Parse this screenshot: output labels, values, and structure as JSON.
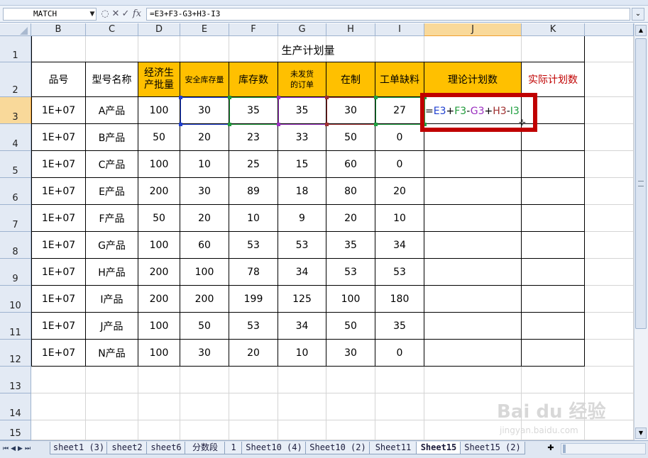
{
  "formula_bar": {
    "name_box": "MATCH",
    "formula": "=E3+F3-G3+H3-I3",
    "fx_label": "fx"
  },
  "columns": [
    "B",
    "C",
    "D",
    "E",
    "F",
    "G",
    "H",
    "I",
    "J",
    "K"
  ],
  "selected_column": "J",
  "rows": [
    "1",
    "2",
    "3",
    "4",
    "5",
    "6",
    "7",
    "8",
    "9",
    "10",
    "11",
    "12",
    "13",
    "14",
    "15"
  ],
  "selected_row": "3",
  "sheet": {
    "title": "生产计划量",
    "headers": [
      "品号",
      "型号名称",
      "经济生产批量",
      "安全库存量",
      "库存数",
      "未发货的订单",
      "在制",
      "工单缺料",
      "理论计划数",
      "实际计划数"
    ],
    "data": [
      [
        "1E+07",
        "A产品",
        "100",
        "30",
        "35",
        "35",
        "30",
        "27"
      ],
      [
        "1E+07",
        "B产品",
        "50",
        "20",
        "23",
        "33",
        "50",
        "0"
      ],
      [
        "1E+07",
        "C产品",
        "100",
        "10",
        "25",
        "15",
        "60",
        "0"
      ],
      [
        "1E+07",
        "E产品",
        "200",
        "30",
        "89",
        "18",
        "80",
        "20"
      ],
      [
        "1E+07",
        "F产品",
        "50",
        "20",
        "10",
        "9",
        "20",
        "10"
      ],
      [
        "1E+07",
        "G产品",
        "100",
        "60",
        "53",
        "53",
        "35",
        "34"
      ],
      [
        "1E+07",
        "H产品",
        "200",
        "100",
        "78",
        "34",
        "53",
        "53"
      ],
      [
        "1E+07",
        "I产品",
        "200",
        "200",
        "199",
        "125",
        "100",
        "180"
      ],
      [
        "1E+07",
        "J产品",
        "100",
        "50",
        "53",
        "34",
        "50",
        "35"
      ],
      [
        "1E+07",
        "N产品",
        "100",
        "30",
        "20",
        "10",
        "30",
        "0"
      ]
    ]
  },
  "edit_formula_parts": [
    {
      "text": "=",
      "color": "#000000"
    },
    {
      "text": "E3",
      "color": "#1f3fd0"
    },
    {
      "text": "+",
      "color": "#000000"
    },
    {
      "text": "F3",
      "color": "#1f9a3a"
    },
    {
      "text": "-",
      "color": "#000000"
    },
    {
      "text": "G3",
      "color": "#9b30c0"
    },
    {
      "text": "+",
      "color": "#000000"
    },
    {
      "text": "H3",
      "color": "#a03030"
    },
    {
      "text": "-",
      "color": "#000000"
    },
    {
      "text": "I3",
      "color": "#1fa040"
    }
  ],
  "sheet_tabs": [
    "sheet1 (3)",
    "sheet2",
    "sheet6",
    "分数段",
    "1",
    "Sheet10 (4)",
    "Sheet10 (2)",
    "Sheet11",
    "Sheet15",
    "Sheet15 (2)"
  ],
  "active_tab": "Sheet15",
  "watermark": {
    "main": "Bai du 经验",
    "sub": "jingyan.baidu.com"
  },
  "colors": {
    "header_fill": "#ffc000",
    "highlight": "#c00000",
    "actual_header_text": "#c00000"
  }
}
